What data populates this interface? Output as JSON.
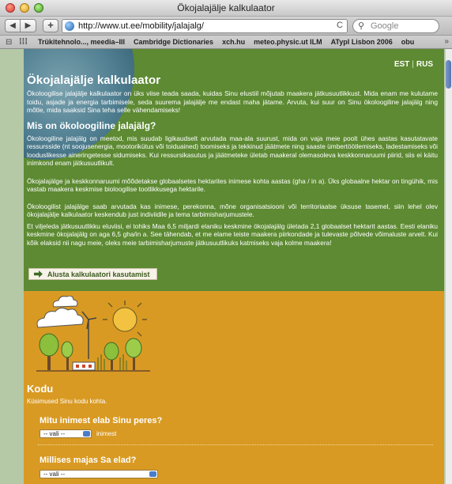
{
  "window": {
    "title": "Ökojalajälje kalkulaator"
  },
  "toolbar": {
    "back": "◀",
    "forward": "▶",
    "add": "+",
    "url": "http://www.ut.ee/mobility/jalajalg/",
    "reload": "C",
    "search_placeholder": "Google"
  },
  "bookmarks": {
    "items": [
      "Trükitehnolo..., meedia–III",
      "Cambridge Dictionaries",
      "xch.hu",
      "meteo.physic.ut ILM",
      "ATypI Lisbon 2006",
      "obu"
    ],
    "more": "»"
  },
  "page": {
    "lang": {
      "est": "EST",
      "sep": "|",
      "rus": "RUS"
    },
    "title": "Ökojalajälje kalkulaator",
    "intro": "Ökoloogilise jalajälje kalkulaator on üks viise teada saada, kuidas Sinu elustiil mõjutab maakera jätkusuutlikkust. Mida enam me kulutame toidu, asjade ja energia tarbimisele, seda suurema jalajälje me endast maha jätame. Arvuta, kui suur on Sinu ökoloogiline jalajälg ning mõtle, mida saaksid Sina teha selle vähendamiseks!",
    "subtitle": "Mis on ökoloogiline jalajälg?",
    "para1": "Ökoloogiline jalajälg on meetod, mis suudab ligikaudselt arvutada maa-ala suurust, mida on vaja meie poolt ühes aastas kasutatavate ressursside (nt soojusenergia, mootorikütus või toiduained) toomiseks ja tekkinud jäätmete ning saaste ümbertöötlemiseks, ladestamiseks või looduslikesse aineringetesse sidumiseks. Kui ressursikasutus ja jäätmeteke ületab maakeral olemasoleva keskkonnaruumi piirid, siis ei käitu inimkond enam jätkusuutlikult.",
    "para2": "Ökojalajälge ja keskkonnaruumi mõõdetakse globaalsetes hektarites inimese kohta aastas (gha / in a). Üks globaalne hektar on tingühik, mis vastab maakera keskmise bioloogilise tootlikkusega hektarile.",
    "para3": "Ökoloogilist jalajälge saab arvutada kas inimese, perekonna, mõne organisatsiooni või territoriaalse üksuse tasemel, siin lehel olev ökojalajälje kalkulaator keskendub just indiviidile ja tema tarbimisharjumustele.",
    "para4": "Et viljeleda jätkusuutlikku eluviisi, ei tohiks Maa 6,5 miljardi elaniku keskmine ökojalajälg ületada 2,1 globaalset hektarit aastas. Eesti elaniku keskmine ökojalajälg on aga 6,5 gha/in a. See tähendab, et me elame teiste maakera piirkondade ja tulevaste põlvede võimaluste arvelt. Kui kõik elaksid nii nagu meie, oleks meie tarbimisharjumuste jätkusuutlikuks katmiseks vaja kolme maakera!",
    "start_button": "Alusta kalkulaatori kasutamist"
  },
  "home": {
    "title": "Kodu",
    "subtitle": "Küsimused Sinu kodu kohta.",
    "q1": "Mitu inimest elab Sinu peres?",
    "q1_select": "-- vali --",
    "q1_unit": "inimest",
    "q2": "Millises majas Sa elad?",
    "q2_select": "-- vali --"
  },
  "colors": {
    "green": "#5d8a32",
    "orange": "#d99a23"
  }
}
